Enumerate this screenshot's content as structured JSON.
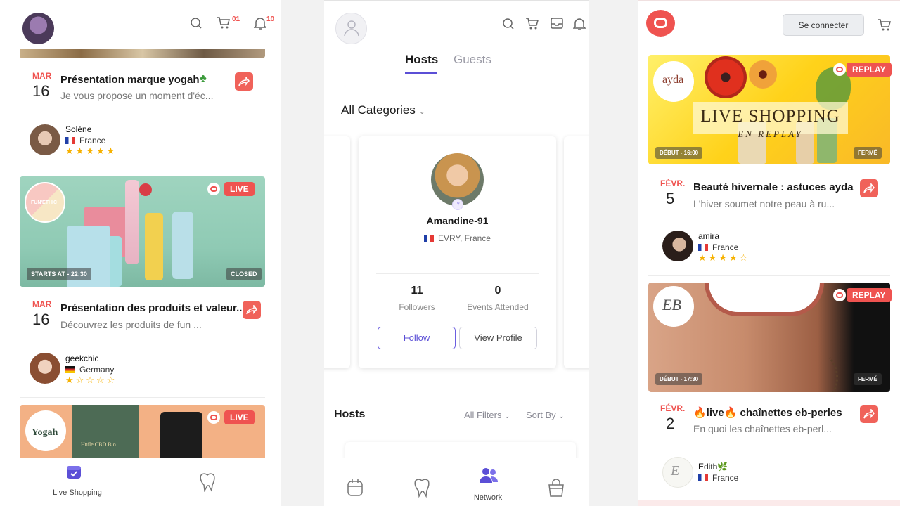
{
  "left": {
    "cart_count": "01",
    "notif_count": "10",
    "events": [
      {
        "month": "MAR",
        "day": "16",
        "title": "Présentation marque yogah",
        "desc": "Je vous propose un moment d'éc...",
        "host": {
          "name": "Solène",
          "country": "France"
        },
        "rating": "★★★★★"
      },
      {
        "status": "LIVE",
        "brand": "FUN'ETHIC",
        "starts": "STARTS AT - 22:30",
        "closed": "CLOSED",
        "month": "MAR",
        "day": "16",
        "title": "Présentation des produits et valeur...",
        "desc": "Découvrez les produits de fun ...",
        "host": {
          "name": "geekchic",
          "country": "Germany"
        },
        "rating": "★☆☆☆☆"
      },
      {
        "status": "LIVE",
        "brand": "Yogah",
        "product": "Huile CBD Bio"
      }
    ],
    "nav": {
      "live_shopping": "Live Shopping"
    }
  },
  "middle": {
    "tabs": {
      "hosts": "Hosts",
      "guests": "Guests"
    },
    "category": "All Categories",
    "profile": {
      "name": "Amandine-91",
      "location": "EVRY, France",
      "followers_count": "11",
      "followers_label": "Followers",
      "events_count": "0",
      "events_label": "Events Attended",
      "follow": "Follow",
      "view": "View Profile"
    },
    "section_title": "Hosts",
    "filters": "All Filters",
    "sort": "Sort By",
    "nav": {
      "network": "Network"
    }
  },
  "right": {
    "login": "Se connecter",
    "events": [
      {
        "status": "REPLAY",
        "brand": "ayda",
        "banner_line1": "LIVE SHOPPING",
        "banner_line2": "EN REPLAY",
        "starts": "DÉBUT - 16:00",
        "closed": "FERMÉ",
        "month": "FÉVR.",
        "day": "5",
        "title": "Beauté hivernale : astuces ayda",
        "desc": "L'hiver soumet notre peau à ru...",
        "host": {
          "name": "amira",
          "country": "France"
        },
        "rating": "★★★★☆"
      },
      {
        "status": "REPLAY",
        "brand": "EB",
        "starts": "DÉBUT - 17:30",
        "closed": "FERMÉ",
        "month": "FÉVR.",
        "day": "2",
        "title": "🔥live🔥 chaînettes eb-perles",
        "desc": "En quoi les chaînettes eb-perl...",
        "host": {
          "name": "Edith🌿",
          "country": "France"
        }
      }
    ]
  },
  "colors": {
    "accent": "#ef5350",
    "primary": "#5b4fd6",
    "star": "#f6b100"
  }
}
